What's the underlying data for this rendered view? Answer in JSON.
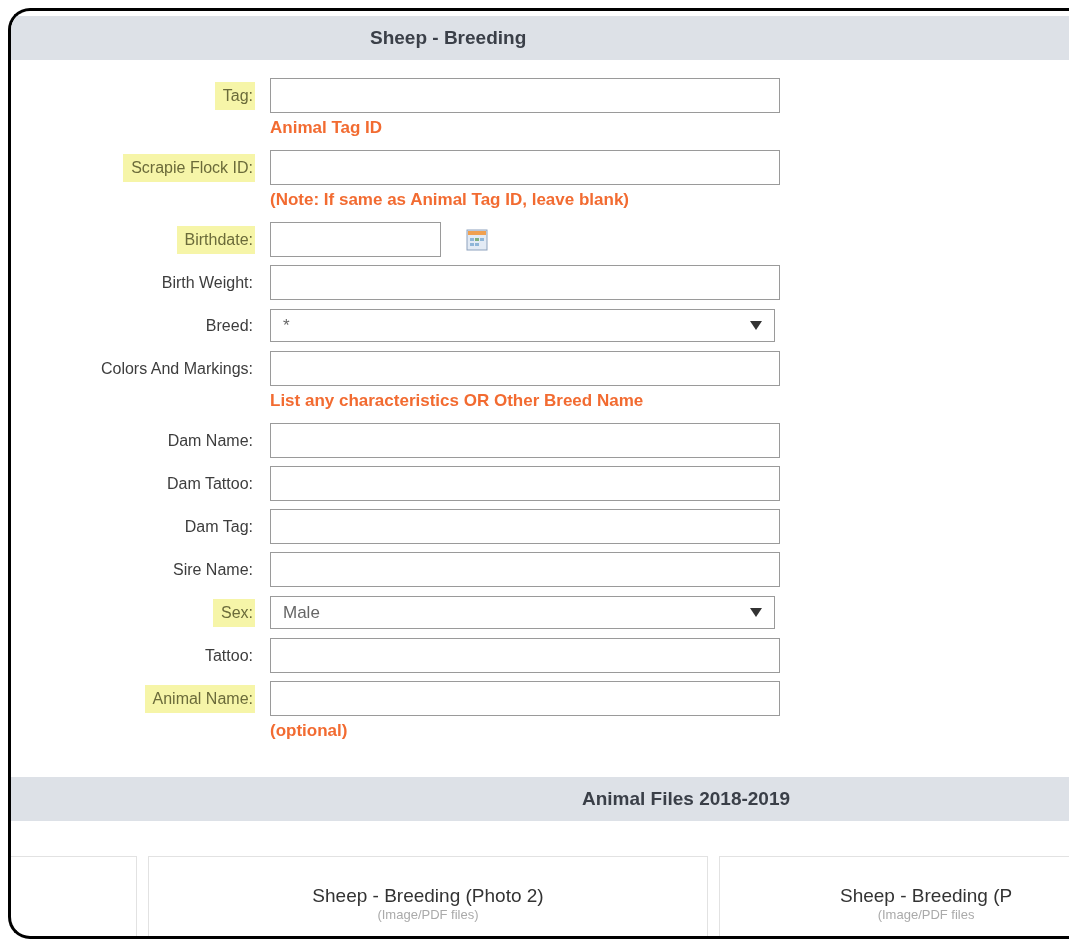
{
  "form_section": {
    "title": "Sheep - Breeding",
    "rows": [
      {
        "kind": "text",
        "label": "Tag:",
        "highlighted": true,
        "hint": "Animal Tag ID"
      },
      {
        "kind": "text",
        "label": "Scrapie Flock ID:",
        "highlighted": true,
        "hint": "(Note: If same as Animal Tag ID, leave blank)"
      },
      {
        "kind": "date",
        "label": "Birthdate:",
        "highlighted": true
      },
      {
        "kind": "text",
        "label": "Birth Weight:",
        "highlighted": false
      },
      {
        "kind": "select",
        "label": "Breed:",
        "highlighted": false,
        "value": "*"
      },
      {
        "kind": "text",
        "label": "Colors And Markings:",
        "highlighted": false,
        "hint": "List any characteristics OR Other Breed Name"
      },
      {
        "kind": "text",
        "label": "Dam Name:",
        "highlighted": false
      },
      {
        "kind": "text",
        "label": "Dam Tattoo:",
        "highlighted": false
      },
      {
        "kind": "text",
        "label": "Dam Tag:",
        "highlighted": false
      },
      {
        "kind": "text",
        "label": "Sire Name:",
        "highlighted": false
      },
      {
        "kind": "select",
        "label": "Sex:",
        "highlighted": true,
        "value": "Male"
      },
      {
        "kind": "text",
        "label": "Tattoo:",
        "highlighted": false
      },
      {
        "kind": "text",
        "label": "Animal Name:",
        "highlighted": true,
        "hint": "(optional)"
      }
    ]
  },
  "files_section": {
    "title": "Animal Files 2018-2019",
    "cards": [
      {
        "title": "Sheep - Breeding (Photo 2)",
        "subtitle": "(Image/PDF files)"
      },
      {
        "title": "Sheep - Breeding (P",
        "subtitle": "(Image/PDF files"
      }
    ]
  }
}
